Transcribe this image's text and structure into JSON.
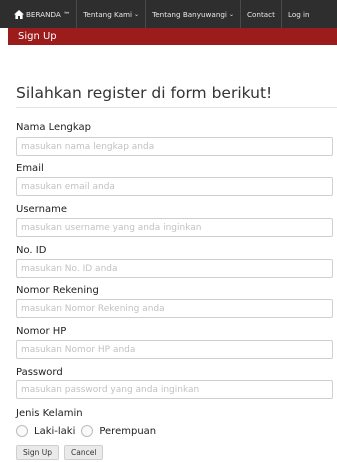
{
  "navbar": {
    "brand": "BERANDA ™",
    "items": [
      {
        "label": "Tentang Kami",
        "dropdown": true
      },
      {
        "label": "Tentang Banyuwangi",
        "dropdown": true
      },
      {
        "label": "Contact",
        "dropdown": false
      },
      {
        "label": "Log in",
        "dropdown": false
      }
    ],
    "sub_label": "Sign Up"
  },
  "page_title": "Silahkan register di form berikut!",
  "fields": [
    {
      "label": "Nama Lengkap",
      "placeholder": "masukan nama lengkap anda"
    },
    {
      "label": "Email",
      "placeholder": "masukan email anda"
    },
    {
      "label": "Username",
      "placeholder": "masukan username yang anda inginkan"
    },
    {
      "label": "No. ID",
      "placeholder": "masukan No. ID anda"
    },
    {
      "label": "Nomor Rekening",
      "placeholder": "masukan Nomor Rekening anda"
    },
    {
      "label": "Nomor HP",
      "placeholder": "masukan Nomor HP anda"
    },
    {
      "label": "Password",
      "placeholder": "masukan password yang anda inginkan"
    }
  ],
  "gender": {
    "label": "Jenis Kelamin",
    "options": [
      "Laki-laki",
      "Perempuan"
    ]
  },
  "buttons": {
    "signup": "Sign Up",
    "cancel": "Cancel"
  },
  "colors": {
    "navbar_bg": "#2e2e2e",
    "subbar_bg": "#9c1c1c"
  }
}
